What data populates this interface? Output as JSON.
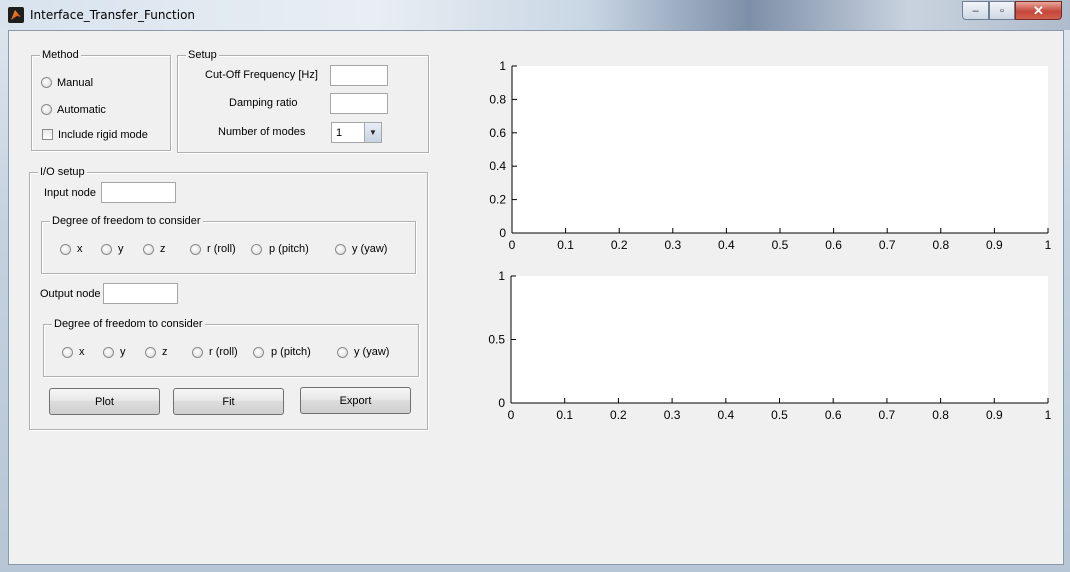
{
  "window": {
    "title": "Interface_Transfer_Function",
    "min_label": "‒",
    "max_label": "▫",
    "close_label": "✕"
  },
  "method": {
    "title": "Method",
    "manual": "Manual",
    "automatic": "Automatic",
    "rigid": "Include rigid mode"
  },
  "setup": {
    "title": "Setup",
    "cutoff_label": "Cut-Off Frequency [Hz]",
    "cutoff_value": "",
    "damping_label": "Damping ratio",
    "damping_value": "",
    "modes_label": "Number of modes",
    "modes_value": "1"
  },
  "io": {
    "title": "I/O setup",
    "input_label": "Input node",
    "input_value": "",
    "output_label": "Output node",
    "output_value": "",
    "dof_title": "Degree of freedom to consider",
    "dof_options": [
      "x",
      "y",
      "z",
      "r (roll)",
      "p  (pitch)",
      "y (yaw)"
    ]
  },
  "buttons": {
    "plot": "Plot",
    "fit": "Fit",
    "export": "Export"
  },
  "chart_data": [
    {
      "type": "line",
      "series": [],
      "x_ticks": [
        "0",
        "0.1",
        "0.2",
        "0.3",
        "0.4",
        "0.5",
        "0.6",
        "0.7",
        "0.8",
        "0.9",
        "1"
      ],
      "y_ticks": [
        "0",
        "0.2",
        "0.4",
        "0.6",
        "0.8",
        "1"
      ],
      "xlim": [
        0,
        1
      ],
      "ylim": [
        0,
        1
      ]
    },
    {
      "type": "line",
      "series": [],
      "x_ticks": [
        "0",
        "0.1",
        "0.2",
        "0.3",
        "0.4",
        "0.5",
        "0.6",
        "0.7",
        "0.8",
        "0.9",
        "1"
      ],
      "y_ticks": [
        "0",
        "0.5",
        "1"
      ],
      "xlim": [
        0,
        1
      ],
      "ylim": [
        0,
        1
      ]
    }
  ]
}
